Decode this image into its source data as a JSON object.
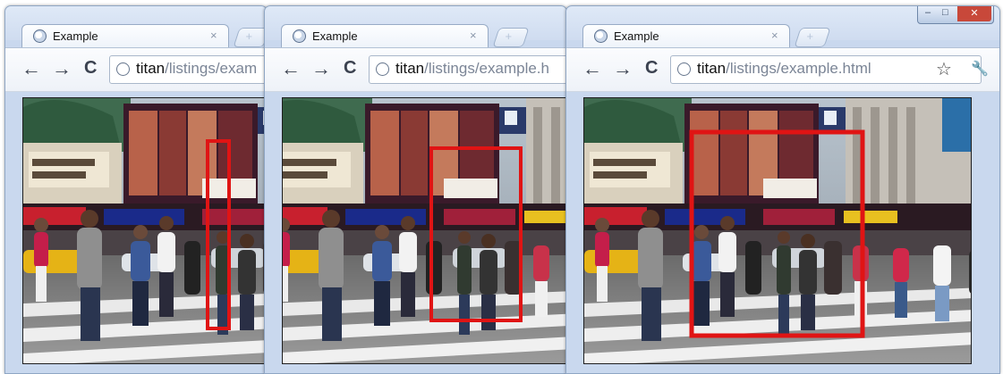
{
  "windows": [
    {
      "tab": {
        "label": "Example",
        "close": "×"
      },
      "newtab_label": "+",
      "nav": {
        "back": "←",
        "forward": "→",
        "reload": "C"
      },
      "url": {
        "host": "titan",
        "path": "/listings/exam"
      },
      "tracking_box": "narrow box around a walking pedestrian on the left side of the frame"
    },
    {
      "tab": {
        "label": "Example",
        "close": "×"
      },
      "newtab_label": "+",
      "nav": {
        "back": "←",
        "forward": "→",
        "reload": "C"
      },
      "url": {
        "host": "titan",
        "path": "/listings/example.h"
      },
      "tracking_box": "box around two pedestrians in red shirts at center"
    },
    {
      "tab": {
        "label": "Example",
        "close": "×"
      },
      "newtab_label": "+",
      "nav": {
        "back": "←",
        "forward": "→",
        "reload": "C"
      },
      "url": {
        "host": "titan",
        "path": "/listings/example.html"
      },
      "star": "☆",
      "wrench": "🔧",
      "window_controls": {
        "minimize": "–",
        "maximize": "□",
        "close": "✕"
      },
      "tracking_box": "large box around a crowd of pedestrians"
    }
  ],
  "colors": {
    "tracking_box": "#e01414",
    "window_frame": "#c9d8ee",
    "close_button": "#c8483a"
  }
}
